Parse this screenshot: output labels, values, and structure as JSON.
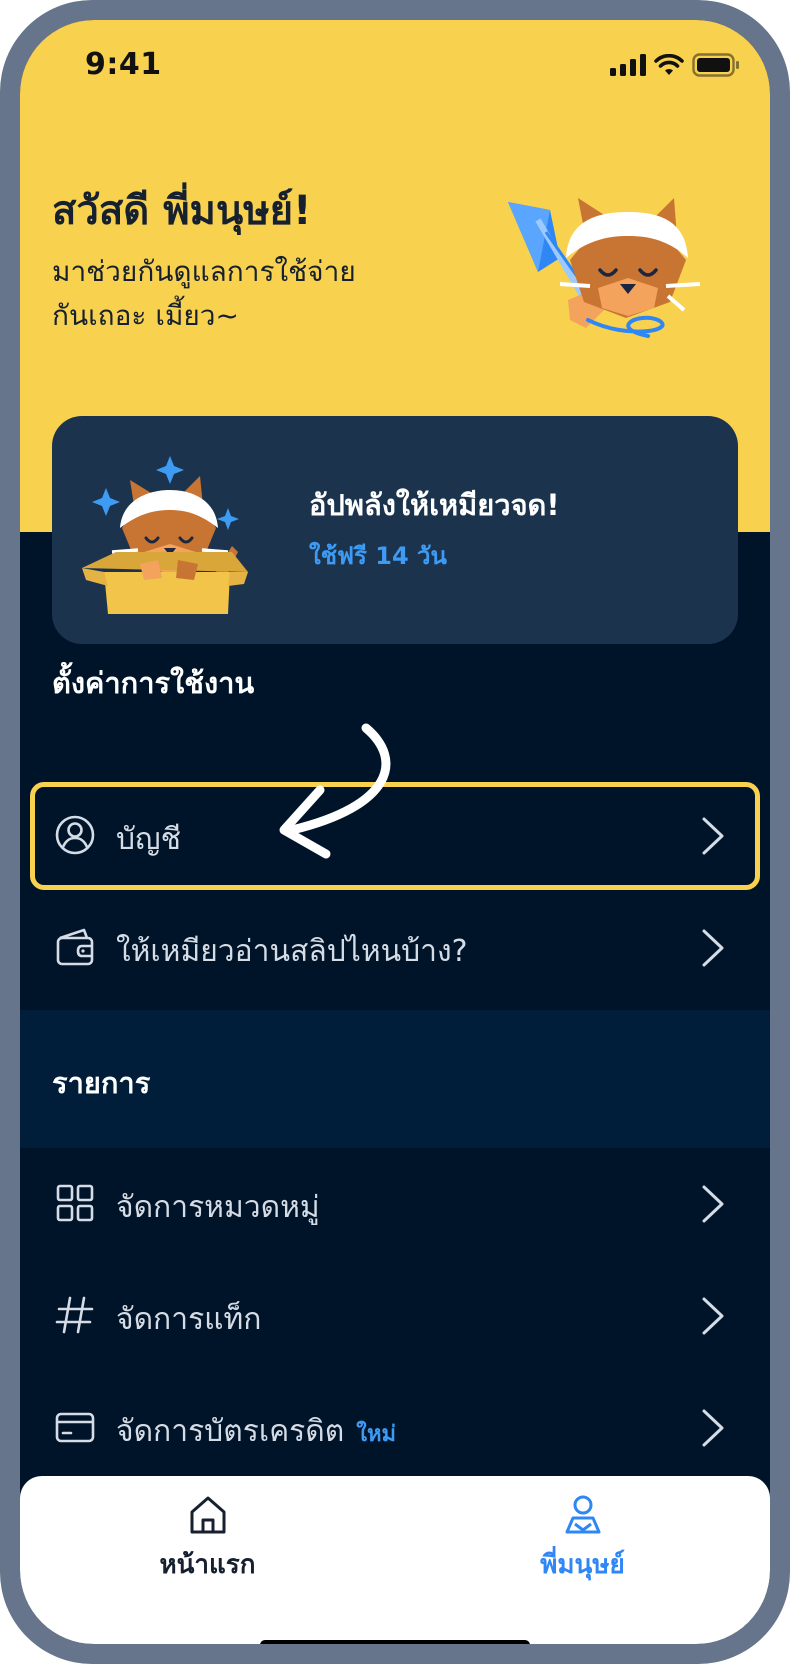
{
  "status_bar": {
    "time": "9:41"
  },
  "hero": {
    "title": "สวัสดี พี่มนุษย์!",
    "subtitle_line1": "มาช่วยกันดูแลการใช้จ่าย",
    "subtitle_line2": "กันเถอะ เมี้ยว~"
  },
  "promo": {
    "title": "อัปพลังให้เหมียวจด!",
    "subtitle": "ใช้ฟรี 14 วัน"
  },
  "settings_section": {
    "title": "ตั้งค่าการใช้งาน",
    "items": [
      {
        "label": "บัญชี",
        "icon": "user-circle-icon"
      },
      {
        "label": "ให้เหมียวอ่านสลิปไหนบ้าง?",
        "icon": "wallet-icon"
      }
    ]
  },
  "list_section": {
    "title": "รายการ",
    "items": [
      {
        "label": "จัดการหมวดหมู่",
        "icon": "grid-icon"
      },
      {
        "label": "จัดการแท็ก",
        "icon": "hashtag-icon"
      },
      {
        "label": "จัดการบัตรเครดิต",
        "icon": "credit-card-icon",
        "badge": "ใหม่"
      }
    ]
  },
  "tabbar": {
    "tabs": [
      {
        "label": "หน้าแรก",
        "icon": "home-icon",
        "active": false
      },
      {
        "label": "พี่มนุษย์",
        "icon": "profile-icon",
        "active": true
      }
    ]
  },
  "colors": {
    "hero_yellow": "#f8d14f",
    "background_navy": "#001429",
    "card_navy": "#1c334e",
    "accent_blue": "#3d9bf4",
    "highlight": "#f8d14f"
  }
}
